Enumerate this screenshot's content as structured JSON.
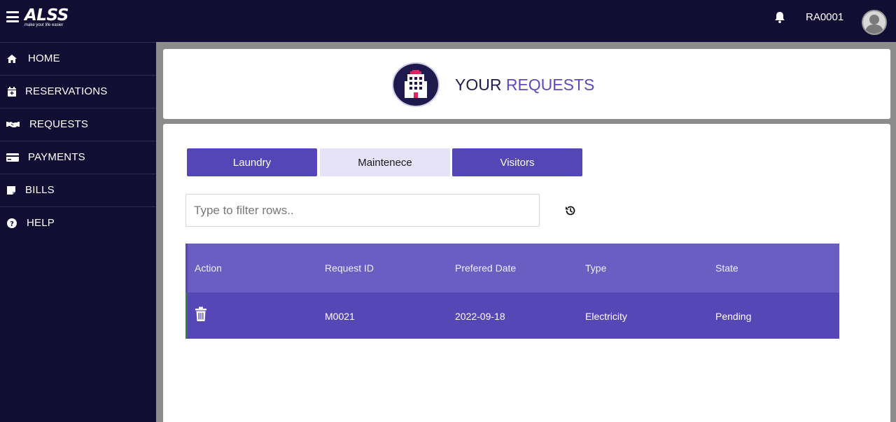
{
  "app": {
    "logo_text": "ALSS",
    "logo_tagline": "make your life easier",
    "user_id": "RA0001"
  },
  "sidebar": {
    "items": [
      {
        "label": "HOME",
        "icon": "home-icon"
      },
      {
        "label": "RESERVATIONS",
        "icon": "calendar-plus-icon"
      },
      {
        "label": "REQUESTS",
        "icon": "handshake-icon"
      },
      {
        "label": "PAYMENTS",
        "icon": "credit-card-icon"
      },
      {
        "label": "BILLS",
        "icon": "sticky-note-icon"
      },
      {
        "label": "HELP",
        "icon": "question-circle-icon"
      }
    ]
  },
  "header": {
    "title_prefix": "YOUR ",
    "title_accent": "REQUESTS",
    "icon": "building-icon"
  },
  "tabs": [
    {
      "label": "Laundry",
      "state": "dark"
    },
    {
      "label": "Maintenece",
      "state": "selected-light"
    },
    {
      "label": "Visitors",
      "state": "dark"
    }
  ],
  "filter": {
    "placeholder": "Type to filter rows..",
    "value": ""
  },
  "table": {
    "columns": [
      "Action",
      "Request ID",
      "Prefered Date",
      "Type",
      "State"
    ],
    "rows": [
      {
        "request_id": "M0021",
        "date": "2022-09-18",
        "type": "Electricity",
        "state": "Pending"
      }
    ]
  },
  "colors": {
    "sidebar_bg": "#120e33",
    "accent": "#5546b8",
    "tab_light": "#e6e3f8",
    "table_header": "#6b5ec2",
    "table_row": "#5646b6"
  }
}
